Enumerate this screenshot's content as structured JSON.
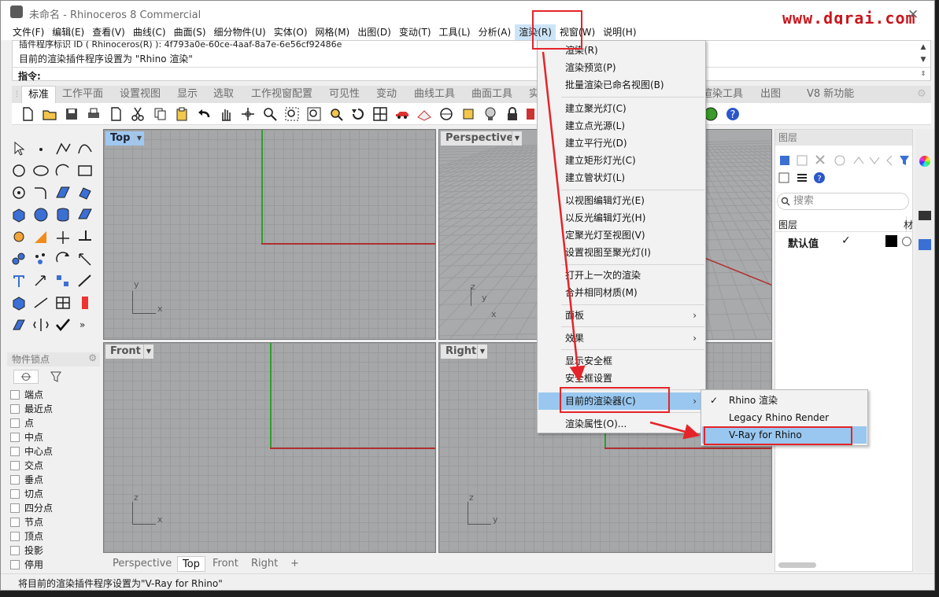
{
  "window": {
    "title": "未命名 - Rhinoceros 8 Commercial",
    "watermark": "www.dgrai.com"
  },
  "menubar": [
    "文件(F)",
    "编辑(E)",
    "查看(V)",
    "曲线(C)",
    "曲面(S)",
    "细分物件(U)",
    "实体(O)",
    "网格(M)",
    "出图(D)",
    "变动(T)",
    "工具(L)",
    "分析(A)",
    "渲染(R)",
    "视窗(W)",
    "说明(H)"
  ],
  "command": {
    "history_1": "插件程序标识 ID ( Rhinoceros(R) ): 4f793a0e-60ce-4aaf-8a7e-6e56cf92486e",
    "history_2": "目前的渲染插件程序设置为 \"Rhino 渲染\"",
    "prompt": "指令:"
  },
  "toolbar_tabs": [
    "标准",
    "工作平面",
    "设置视图",
    "显示",
    "选取",
    "工作视窗配置",
    "可见性",
    "变动",
    "曲线工具",
    "曲面工具",
    "实",
    "渲染工具",
    "出图",
    "V8 新功能"
  ],
  "osnap": {
    "title": "物件锁点",
    "items": [
      "端点",
      "最近点",
      "点",
      "中点",
      "中心点",
      "交点",
      "垂点",
      "切点",
      "四分点",
      "节点",
      "顶点",
      "投影",
      "停用"
    ]
  },
  "viewports": {
    "top": "Top",
    "perspective": "Perspective",
    "front": "Front",
    "right": "Right"
  },
  "axes": {
    "x": "x",
    "y": "y",
    "z": "z"
  },
  "viewport_tabs": [
    "Perspective",
    "Top",
    "Front",
    "Right"
  ],
  "add_tab": "+",
  "layers": {
    "title": "图层",
    "search_placeholder": "搜索",
    "col_layer": "图层",
    "col_material": "材",
    "rows": [
      {
        "name": "默认值",
        "check": "✓"
      }
    ]
  },
  "render_menu": {
    "items": [
      {
        "label": "渲染(R)"
      },
      {
        "label": "渲染预览(P)"
      },
      {
        "label": "批量渲染已命名视图(B)"
      },
      {
        "label": "建立聚光灯(C)"
      },
      {
        "label": "建立点光源(L)"
      },
      {
        "label": "建立平行光(D)"
      },
      {
        "label": "建立矩形灯光(C)"
      },
      {
        "label": "建立管状灯(L)"
      },
      {
        "label": "以视图编辑灯光(E)"
      },
      {
        "label": "以反光编辑灯光(H)"
      },
      {
        "label": "定聚光灯至视图(V)"
      },
      {
        "label": "设置视图至聚光灯(I)"
      },
      {
        "label": "打开上一次的渲染"
      },
      {
        "label": "合并相同材质(M)"
      },
      {
        "label": "面板"
      },
      {
        "label": "效果"
      },
      {
        "label": "显示安全框"
      },
      {
        "label": "安全框设置"
      },
      {
        "label": "目前的渲染器(C)"
      },
      {
        "label": "渲染属性(O)..."
      }
    ]
  },
  "renderer_submenu": {
    "check": "✓",
    "items": [
      "Rhino 渲染",
      "Legacy Rhino Render",
      "V-Ray for Rhino"
    ]
  },
  "status": "将目前的渲染插件程序设置为\"V-Ray for Rhino\"",
  "colors": {
    "highlight": "#99c7ef",
    "annotation_red": "#e4242a",
    "viewport_grid": "#a6a7a9",
    "x_axis": "#b03030",
    "y_axis": "#2e9e2e"
  }
}
